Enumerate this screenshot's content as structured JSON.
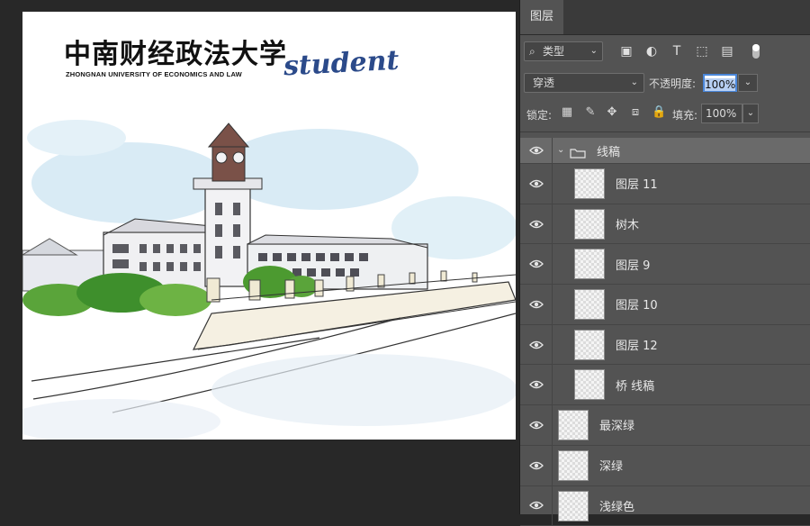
{
  "document": {
    "logo_cn": "中南财经政法大学",
    "logo_en": "ZHONGNAN UNIVERSITY OF ECONOMICS AND LAW",
    "student_text": "student"
  },
  "panel": {
    "tab_label": "图层",
    "filter": {
      "label": "类型"
    },
    "blend_mode": "穿透",
    "opacity_label": "不透明度:",
    "opacity_value": "100%",
    "lock_label": "锁定:",
    "fill_label": "填充:",
    "fill_value": "100%"
  },
  "layers": [
    {
      "name": "线稿",
      "type": "group",
      "visible": true
    },
    {
      "name": "图层 11",
      "type": "layer",
      "visible": true,
      "indent": true
    },
    {
      "name": "树木",
      "type": "layer",
      "visible": true,
      "indent": true
    },
    {
      "name": "图层 9",
      "type": "layer",
      "visible": true,
      "indent": true
    },
    {
      "name": "图层 10",
      "type": "layer",
      "visible": true,
      "indent": true
    },
    {
      "name": "图层 12",
      "type": "layer",
      "visible": true,
      "indent": true
    },
    {
      "name": "桥 线稿",
      "type": "layer",
      "visible": true,
      "indent": true
    },
    {
      "name": "最深绿",
      "type": "layer",
      "visible": true,
      "indent": false
    },
    {
      "name": "深绿",
      "type": "layer",
      "visible": true,
      "indent": false
    },
    {
      "name": "浅绿色",
      "type": "layer",
      "visible": true,
      "indent": false
    }
  ],
  "colors": {
    "panel_bg": "#535353",
    "canvas_bg": "#282828",
    "accent": "#4a86d8"
  },
  "icons": [
    "search-icon",
    "image-filter-icon",
    "adjustment-filter-icon",
    "type-filter-icon",
    "shape-filter-icon",
    "smart-object-filter-icon",
    "filter-toggle-icon",
    "lock-transparent-icon",
    "lock-paint-icon",
    "lock-position-icon",
    "lock-artboard-icon",
    "lock-all-icon",
    "eye-icon",
    "folder-icon"
  ]
}
